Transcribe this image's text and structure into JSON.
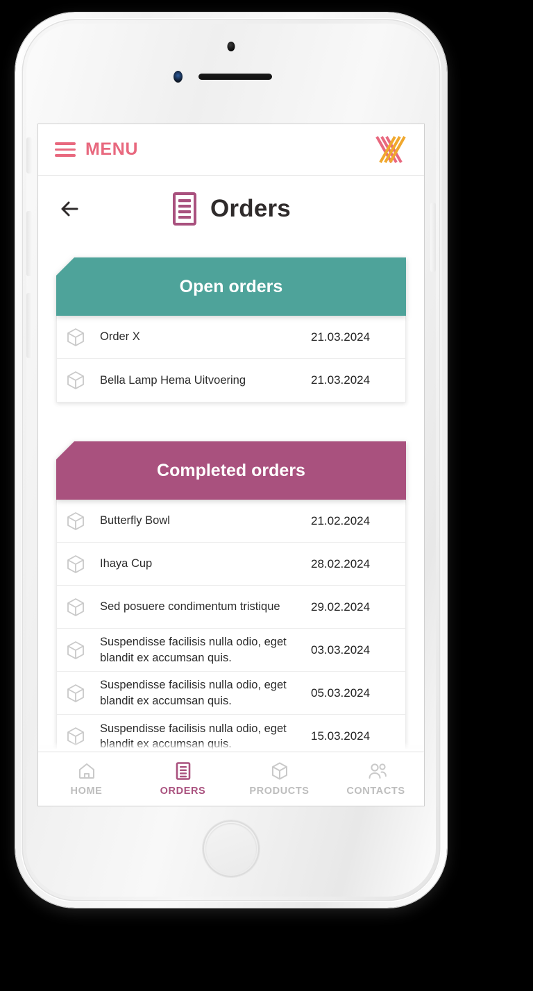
{
  "device": {
    "frame": "iphone-white-mockup",
    "home_button": "home-button",
    "buttons": [
      "mute-switch",
      "volume-up",
      "volume-down",
      "power"
    ]
  },
  "topbar": {
    "menu_label": "MENU",
    "menu_icon": "hamburger-icon",
    "logo_icon": "brand-logo-icon",
    "colors": {
      "menu": "#e8687e",
      "logo_pink": "#e8687e",
      "logo_yellow": "#f0a82e"
    }
  },
  "page": {
    "back_icon": "back-arrow-icon",
    "title_icon": "document-icon",
    "title": "Orders"
  },
  "sections": [
    {
      "id": "open-orders",
      "header": "Open orders",
      "color": "#4ea39a",
      "rows": [
        {
          "icon": "package-icon",
          "name": "Order X",
          "date": "21.03.2024"
        },
        {
          "icon": "package-icon",
          "name": "Bella Lamp Hema Uitvoering",
          "date": "21.03.2024"
        }
      ]
    },
    {
      "id": "completed-orders",
      "header": "Completed orders",
      "color": "#a9517e",
      "rows": [
        {
          "icon": "package-icon",
          "name": "Butterfly Bowl",
          "date": "21.02.2024"
        },
        {
          "icon": "package-icon",
          "name": "Ihaya Cup",
          "date": "28.02.2024"
        },
        {
          "icon": "package-icon",
          "name": "Sed posuere condimentum tristique",
          "date": "29.02.2024"
        },
        {
          "icon": "package-icon",
          "name": "Suspendisse facilisis nulla odio, eget blandit ex accumsan quis.",
          "date": "03.03.2024"
        },
        {
          "icon": "package-icon",
          "name": "Suspendisse facilisis nulla odio, eget blandit ex accumsan quis.",
          "date": "05.03.2024"
        },
        {
          "icon": "package-icon",
          "name": "Suspendisse facilisis nulla odio, eget blandit ex accumsan quis.",
          "date": "15.03.2024"
        }
      ]
    }
  ],
  "bottom_nav": {
    "active": "ORDERS",
    "active_color": "#a9517e",
    "inactive_color": "#bdbdbd",
    "items": [
      {
        "label": "HOME",
        "icon": "home-icon",
        "active": false
      },
      {
        "label": "ORDERS",
        "icon": "document-icon",
        "active": true
      },
      {
        "label": "PRODUCTS",
        "icon": "package-icon",
        "active": false
      },
      {
        "label": "CONTACTS",
        "icon": "users-icon",
        "active": false
      }
    ]
  }
}
